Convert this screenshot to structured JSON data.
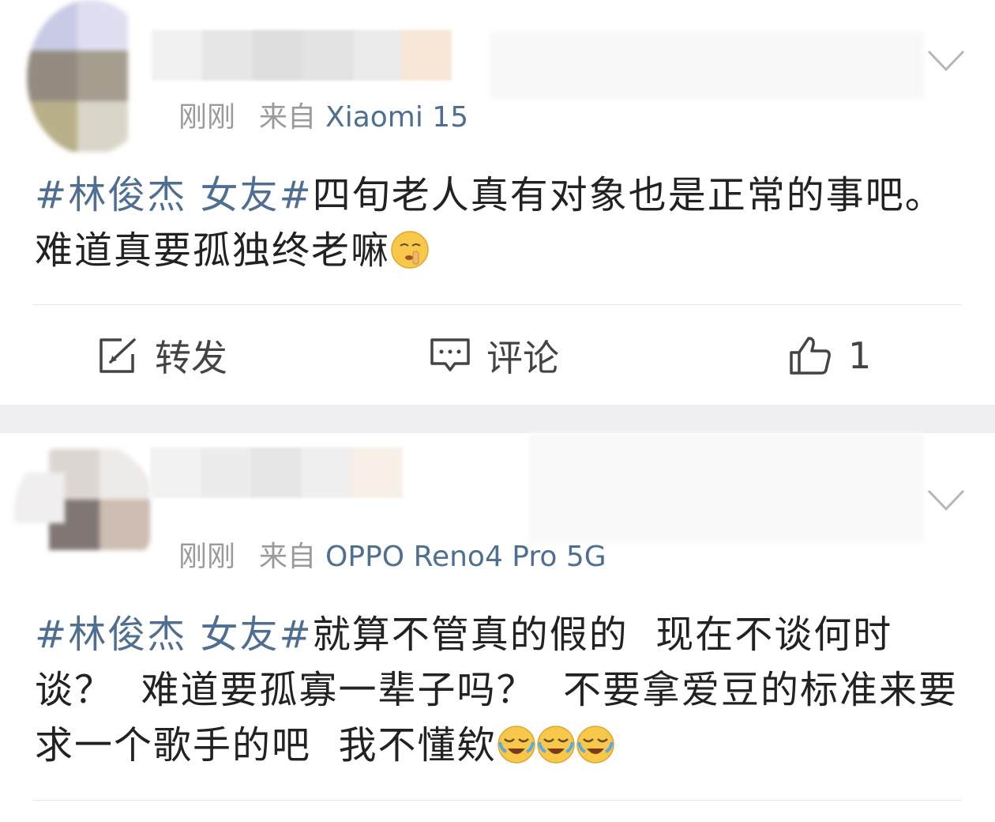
{
  "posts": [
    {
      "time": "刚刚",
      "from_label": "来自",
      "device": "Xiaomi 15",
      "topic": "#林俊杰 女友#",
      "body": "四旬老人真有对象也是正常的事吧。难道真要孤独终老嘛",
      "emojis": [
        "shush-face"
      ],
      "actions": {
        "repost_label": "转发",
        "comment_label": "评论",
        "like_count": "1"
      }
    },
    {
      "time": "刚刚",
      "from_label": "来自",
      "device": "OPPO Reno4 Pro 5G",
      "topic": "#林俊杰 女友#",
      "body": "就算不管真的假的  现在不谈何时谈？  难道要孤寡一辈子吗？  不要拿爱豆的标准来要求一个歌手的吧  我不懂欸",
      "emojis": [
        "laugh-cry-face",
        "laugh-cry-face",
        "laugh-cry-face"
      ]
    }
  ],
  "colors": {
    "topic_link": "#4f6f92",
    "meta_gray": "#9a9a9a",
    "section_gap": "#efeff1"
  }
}
